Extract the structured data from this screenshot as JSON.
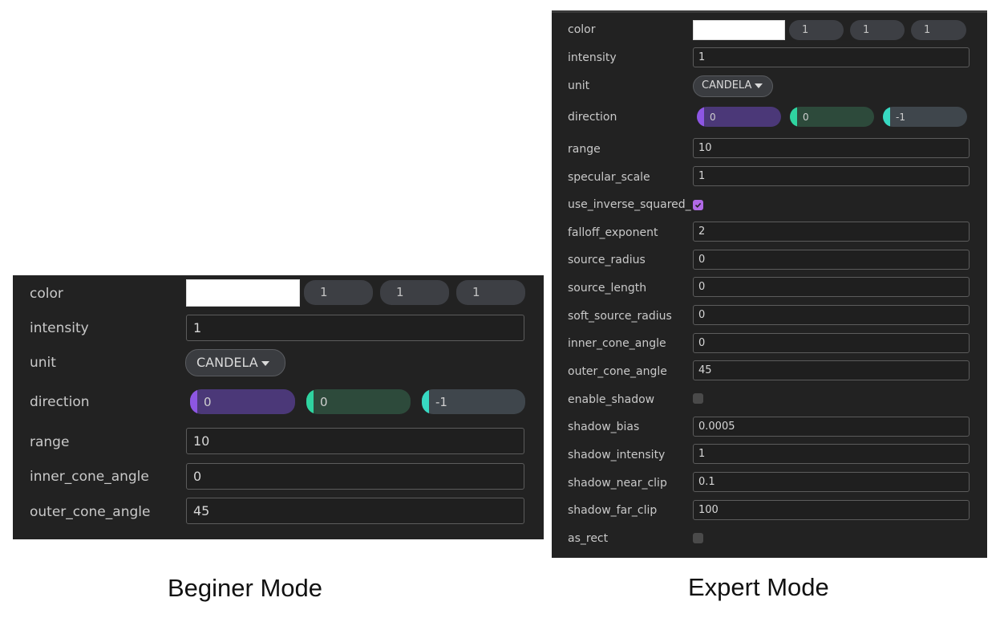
{
  "colors": {
    "panel_bg": "#222222",
    "field_border": "#5c5c5c",
    "slider_x_bg": "#4b3878",
    "slider_x_knob": "#8d56e3",
    "slider_y_bg": "#2d4a3b",
    "slider_y_knob": "#2fd4a0",
    "slider_z_bg": "#3f464c",
    "slider_z_knob": "#37d9c2",
    "checkbox_checked": "#b069e6"
  },
  "beginner": {
    "caption": "Beginer Mode",
    "color": {
      "label": "color",
      "swatch": "#ffffff",
      "r": "1",
      "g": "1",
      "b": "1"
    },
    "intensity": {
      "label": "intensity",
      "value": "1"
    },
    "unit": {
      "label": "unit",
      "value": "CANDELA"
    },
    "direction": {
      "label": "direction",
      "x": "0",
      "y": "0",
      "z": "-1"
    },
    "range": {
      "label": "range",
      "value": "10"
    },
    "inner_cone_angle": {
      "label": "inner_cone_angle",
      "value": "0"
    },
    "outer_cone_angle": {
      "label": "outer_cone_angle",
      "value": "45"
    }
  },
  "expert": {
    "caption": "Expert Mode",
    "color": {
      "label": "color",
      "swatch": "#ffffff",
      "r": "1",
      "g": "1",
      "b": "1"
    },
    "intensity": {
      "label": "intensity",
      "value": "1"
    },
    "unit": {
      "label": "unit",
      "value": "CANDELA"
    },
    "direction": {
      "label": "direction",
      "x": "0",
      "y": "0",
      "z": "-1"
    },
    "range": {
      "label": "range",
      "value": "10"
    },
    "specular_scale": {
      "label": "specular_scale",
      "value": "1"
    },
    "use_inverse_squared": {
      "label": "use_inverse_squared_",
      "checked": true
    },
    "falloff_exponent": {
      "label": "falloff_exponent",
      "value": "2"
    },
    "source_radius": {
      "label": "source_radius",
      "value": "0"
    },
    "source_length": {
      "label": "source_length",
      "value": "0"
    },
    "soft_source_radius": {
      "label": "soft_source_radius",
      "value": "0"
    },
    "inner_cone_angle": {
      "label": "inner_cone_angle",
      "value": "0"
    },
    "outer_cone_angle": {
      "label": "outer_cone_angle",
      "value": "45"
    },
    "enable_shadow": {
      "label": "enable_shadow",
      "checked": false
    },
    "shadow_bias": {
      "label": "shadow_bias",
      "value": "0.0005"
    },
    "shadow_intensity": {
      "label": "shadow_intensity",
      "value": "1"
    },
    "shadow_near_clip": {
      "label": "shadow_near_clip",
      "value": "0.1"
    },
    "shadow_far_clip": {
      "label": "shadow_far_clip",
      "value": "100"
    },
    "as_rect": {
      "label": "as_rect",
      "checked": false
    }
  }
}
